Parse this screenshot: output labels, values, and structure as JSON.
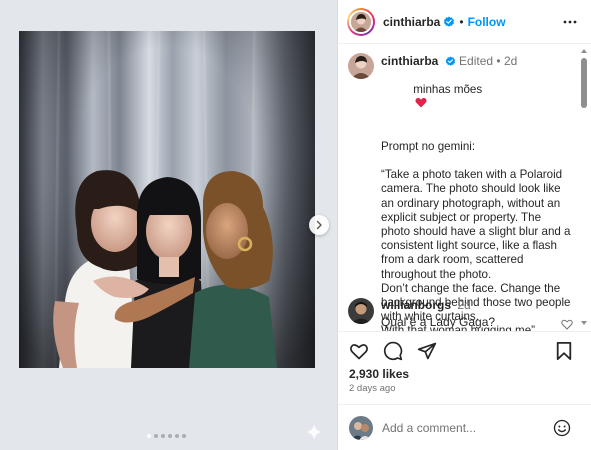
{
  "post": {
    "username": "cinthiarba",
    "follow_label": "Follow",
    "separator": "•",
    "caption": {
      "username": "cinthiarba",
      "edited": "Edited",
      "dot": "•",
      "age": "2d",
      "text": "minhas mões",
      "prompt_text": "Prompt no gemini:\n\n“Take a photo taken with a Polaroid camera. The photo should look like an ordinary photograph, without an explicit subject or property. The photo should have a slight blur and a consistent light source, like a flash from a dark room, scattered throughout the photo.\nDon’t change the face. Change the background behind those two people with white curtains.\nWith that woman hugging me”"
    },
    "comment": {
      "username": "willianborgs",
      "age": "2d",
      "text": "Qual é a Lady Gaga?"
    },
    "likes": "2,930 likes",
    "time_ago": "2 days ago",
    "add_comment_placeholder": "Add a comment..."
  },
  "carousel": {
    "slide_count": 6,
    "active_index": 0
  },
  "icons": {
    "verified": "verified-badge-icon",
    "more": "more-options-icon",
    "like": "heart-icon",
    "comment": "comment-icon",
    "share": "share-icon",
    "save": "bookmark-icon",
    "emoji": "emoji-icon",
    "next": "chevron-right-icon",
    "sparkle": "sparkle-icon"
  },
  "colors": {
    "accent": "#0095f6",
    "heart": "#ed4956",
    "verified": "#0095f6"
  }
}
